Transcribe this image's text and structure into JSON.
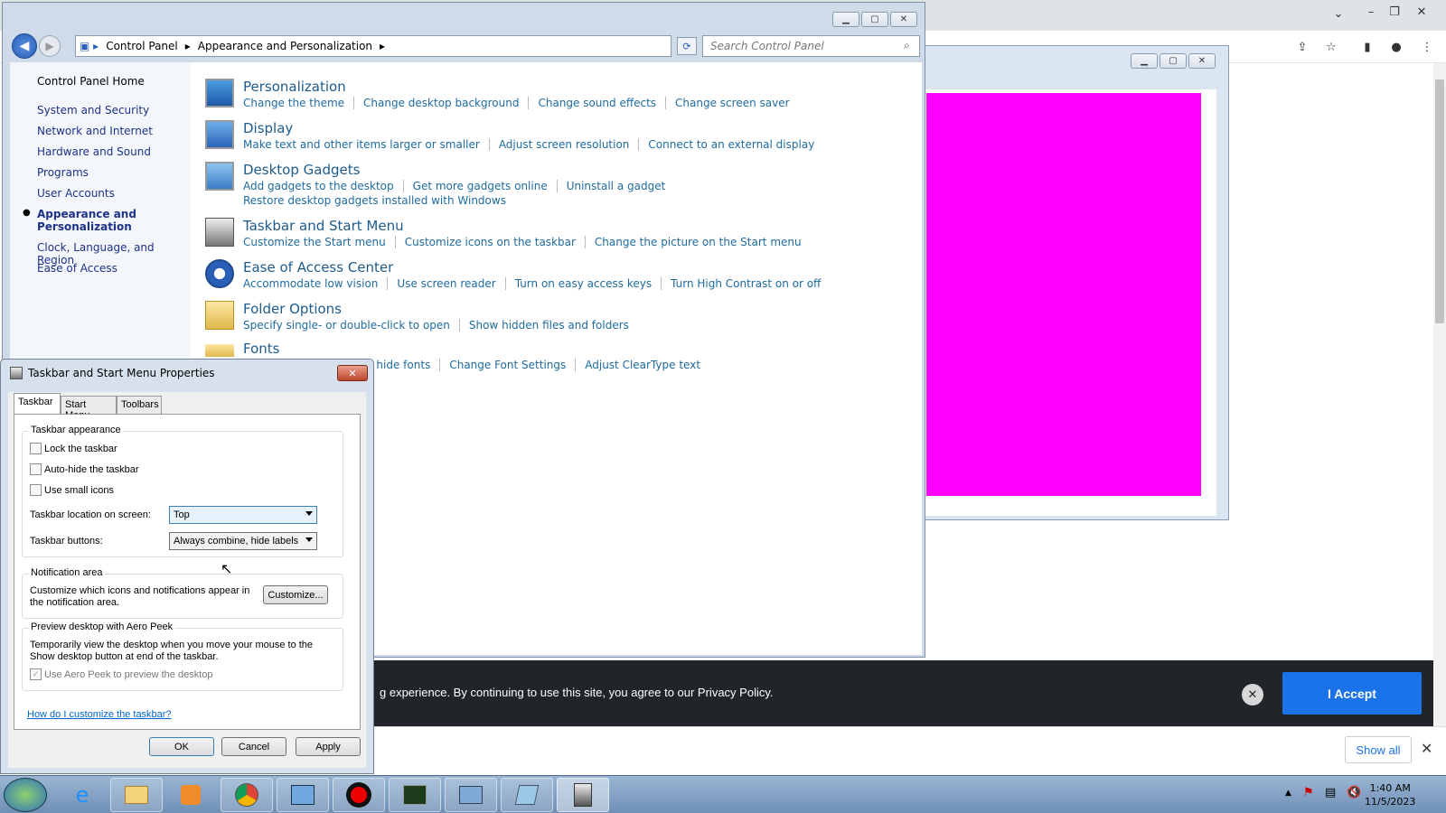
{
  "browser": {
    "cookie_text": "g experience. By continuing to use this site, you agree to our Privacy Policy.",
    "accept_label": "I Accept",
    "show_all_label": "Show all"
  },
  "control_panel": {
    "breadcrumb": [
      "Control Panel",
      "Appearance and Personalization"
    ],
    "search_placeholder": "Search Control Panel",
    "nav": [
      "Control Panel Home",
      "System and Security",
      "Network and Internet",
      "Hardware and Sound",
      "Programs",
      "User Accounts",
      "Appearance and Personalization",
      "Clock, Language, and Region",
      "Ease of Access"
    ],
    "categories": [
      {
        "title": "Personalization",
        "links": [
          "Change the theme",
          "Change desktop background",
          "Change sound effects",
          "Change screen saver"
        ]
      },
      {
        "title": "Display",
        "links": [
          "Make text and other items larger or smaller",
          "Adjust screen resolution",
          "Connect to an external display"
        ]
      },
      {
        "title": "Desktop Gadgets",
        "links": [
          "Add gadgets to the desktop",
          "Get more gadgets online",
          "Uninstall a gadget"
        ],
        "links2": [
          "Restore desktop gadgets installed with Windows"
        ]
      },
      {
        "title": "Taskbar and Start Menu",
        "links": [
          "Customize the Start menu",
          "Customize icons on the taskbar",
          "Change the picture on the Start menu"
        ]
      },
      {
        "title": "Ease of Access Center",
        "links": [
          "Accommodate low vision",
          "Use screen reader",
          "Turn on easy access keys",
          "Turn High Contrast on or off"
        ]
      },
      {
        "title": "Folder Options",
        "links": [
          "Specify single- or double-click to open",
          "Show hidden files and folders"
        ]
      },
      {
        "title": "Fonts",
        "links": [
          "d hide fonts",
          "Change Font Settings",
          "Adjust ClearType text"
        ]
      }
    ]
  },
  "dialog": {
    "title": "Taskbar and Start Menu Properties",
    "tabs": [
      "Taskbar",
      "Start Menu",
      "Toolbars"
    ],
    "appearance_title": "Taskbar appearance",
    "lock_label": "Lock the taskbar",
    "autohide_label": "Auto-hide the taskbar",
    "small_icons_label": "Use small icons",
    "location_label": "Taskbar location on screen:",
    "location_value": "Top",
    "buttons_label": "Taskbar buttons:",
    "buttons_value": "Always combine, hide labels",
    "notif_title": "Notification area",
    "notif_text": "Customize which icons and notifications appear in the notification area.",
    "customize_label": "Customize...",
    "peek_title": "Preview desktop with Aero Peek",
    "peek_text": "Temporarily view the desktop when you move your mouse to the Show desktop button at end of the taskbar.",
    "peek_check_label": "Use Aero Peek to preview the desktop",
    "help_link": "How do I customize the taskbar?",
    "ok_label": "OK",
    "cancel_label": "Cancel",
    "apply_label": "Apply"
  },
  "taskbar": {
    "time": "1:40 AM",
    "date": "11/5/2023"
  },
  "colors": {
    "magenta": "#ff00ff",
    "accept": "#1a73e8",
    "link": "#1e6b9f"
  }
}
